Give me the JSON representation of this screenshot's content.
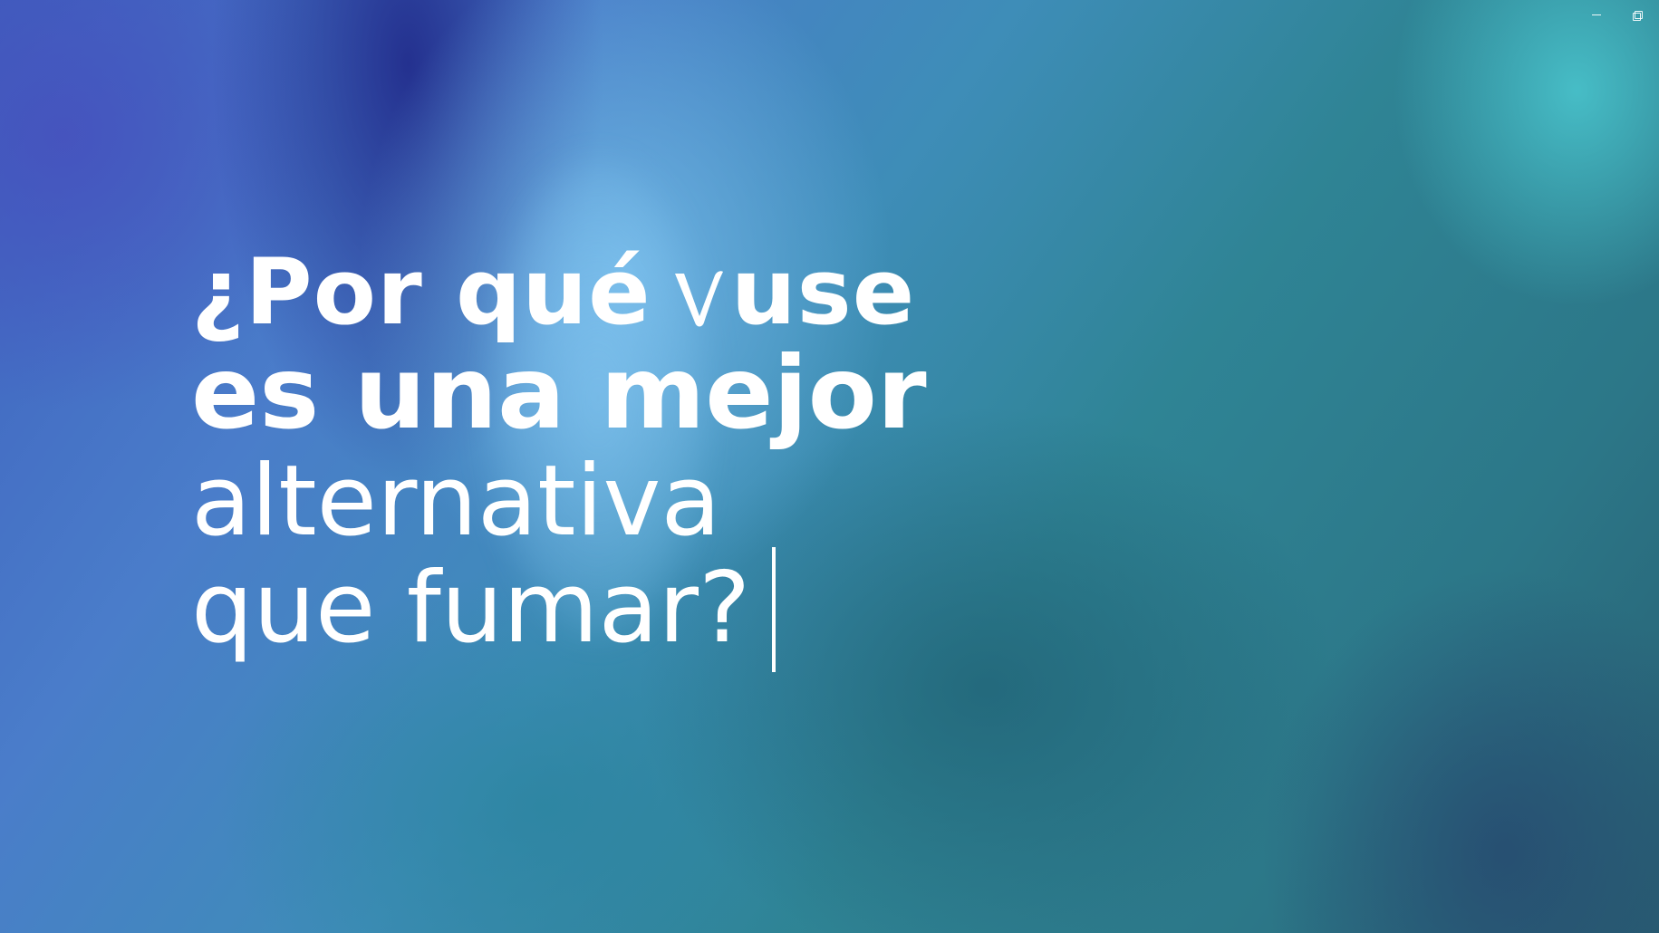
{
  "window_controls": {
    "minimize_label": "",
    "restore_label": ""
  },
  "headline": {
    "line1_prefix": "¿Por qué",
    "line1_brand_suffix": "use",
    "line2": "es una mejor",
    "line3": "alternativa",
    "line4": "que fumar?"
  },
  "icons": {
    "brand_mark": "vuse-v-icon",
    "minimize": "minimize-icon",
    "restore": "restore-icon"
  },
  "colors": {
    "text": "#ffffff",
    "background_primary": "#2f7c8c",
    "background_blue": "#3e5fbe",
    "background_teal": "#4bc8d0"
  }
}
